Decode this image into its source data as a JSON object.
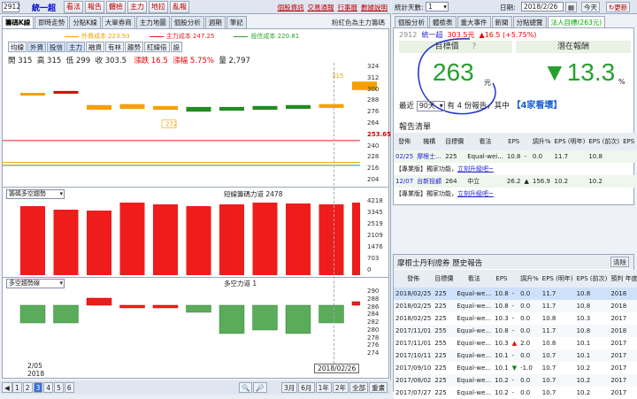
{
  "top_left": {
    "stock_code": "2912",
    "stock_name": "統一超",
    "buttons": [
      "看法",
      "報告",
      "體檢",
      "主力",
      "地拉",
      "亂報"
    ],
    "links": [
      "個股資訊",
      "交易通報",
      "行事曆",
      "數據說明"
    ]
  },
  "top_right": {
    "days_label": "統計天數:",
    "days_value": "1",
    "date_label": "日期:",
    "date_value": "2018/2/26",
    "today_btn": "今天",
    "refresh_btn": "更新"
  },
  "left_tabs": [
    "籌碼K線",
    "即時走勢",
    "分點K線",
    "大單券商",
    "主力地圖",
    "個股分析",
    "週期",
    "筆記"
  ],
  "chart_link": "粉紅色為主力籌碼",
  "legend": [
    {
      "label": "外資成本 223.93",
      "color": "#f5a000"
    },
    {
      "label": "主力成本 247.25",
      "color": "#e02020"
    },
    {
      "label": "投信成本 220.81",
      "color": "#2aa02a"
    }
  ],
  "toolbar": [
    "均線",
    "外資",
    "投信",
    "主力",
    "融資",
    "有林",
    "趨勢",
    "紅線倍",
    "設"
  ],
  "ohlc": {
    "open": "開 315",
    "high": "高 315",
    "low": "低 299",
    "close": "收 303.5",
    "change": "漲跌 16.5",
    "pct": "漲幅 5.75%",
    "volume": "量 2,797"
  },
  "price_ticks": [
    "324",
    "312",
    "300",
    "288",
    "276",
    "264",
    "253.65",
    "240",
    "228",
    "216",
    "204"
  ],
  "annotations": {
    "high_label": "315",
    "low_label": "272"
  },
  "chips_panel": {
    "select": "籌碼多空趨勢",
    "legend": "短線籌碼力道 2478",
    "ticks": [
      "4218",
      "3345",
      "2519",
      "2109",
      "1476",
      "703",
      "0"
    ]
  },
  "bullbear_panel": {
    "select": "多空趨勢線",
    "legend": "多空力道 1",
    "ticks": [
      "290",
      "288",
      "286",
      "284",
      "282",
      "280",
      "278",
      "276",
      "274"
    ]
  },
  "x_labels": {
    "left_date": "2/05",
    "left_year": "2018",
    "right_date": "2018/02/26"
  },
  "pager": [
    "1",
    "2",
    "3",
    "4",
    "5",
    "6"
  ],
  "range_btns": [
    "3月",
    "6月",
    "1年",
    "2年",
    "全部",
    "重畫"
  ],
  "chart_data": [
    {
      "type": "candlestick",
      "title": "",
      "candles": [
        {
          "o": 298,
          "c": 296,
          "color": "#f5a000"
        },
        {
          "o": 300,
          "c": 298,
          "color": "#e00000"
        },
        {
          "o": 285,
          "c": 280,
          "color": "#f5a000"
        },
        {
          "o": 286,
          "c": 281,
          "color": "#f5a000"
        },
        {
          "o": 284,
          "c": 280,
          "color": "#f5a000"
        },
        {
          "o": 283,
          "c": 278,
          "color": "#228b22"
        },
        {
          "o": 283,
          "c": 279,
          "color": "#228b22"
        },
        {
          "o": 284,
          "c": 280,
          "color": "#228b22"
        },
        {
          "o": 285,
          "c": 281,
          "color": "#228b22"
        },
        {
          "o": 286,
          "c": 282,
          "color": "#f5a000"
        },
        {
          "o": 310,
          "c": 301,
          "color": "#f5a000"
        }
      ],
      "ylim": [
        200,
        330
      ]
    },
    {
      "type": "bar",
      "title": "短線籌碼力道 2478",
      "values": [
        3900,
        3700,
        3650,
        4100,
        4000,
        3900,
        4000,
        4100,
        4050,
        4000,
        4100
      ],
      "ylim": [
        0,
        4400
      ]
    },
    {
      "type": "bar",
      "title": "多空力道 1",
      "values": [
        -5,
        -5,
        2,
        0,
        0,
        -2,
        -8,
        -7,
        -8,
        -5,
        1
      ],
      "ylim": [
        -15,
        5
      ]
    }
  ],
  "right_tabs": [
    "個股分析",
    "體檢表",
    "重大事件",
    "新聞",
    "分點總覽",
    "法人目標(263元)"
  ],
  "stock_header": {
    "code": "2912",
    "name": "統一超",
    "price": "303.5元",
    "change": "▲16.5 (+5.75%)"
  },
  "target": {
    "label": "目標價",
    "help": "?",
    "value": "263",
    "unit": "元",
    "upside_label": "潛在報酬",
    "upside_value": "▼13.3",
    "upside_unit": "%"
  },
  "recent": {
    "prefix": "最近",
    "select": "90天",
    "middle": "有 4 份報告，其中",
    "highlight": "【4家看壞】"
  },
  "report_table": {
    "title": "報告清單",
    "headers": [
      "發佈",
      "機構",
      "目標價",
      "看法",
      "EPS",
      "",
      "調升%",
      "EPS (明年)",
      "EPS (前次)",
      "EPS (前次)"
    ],
    "rows": [
      {
        "date": "02/25",
        "inst": "摩根士...",
        "target": "225",
        "view": "Equal-wei...",
        "eps": "10.8",
        "arrow": "-",
        "pct": "0.0",
        "eps1": "11.7",
        "eps2": "10.8"
      },
      {
        "promo": "【專業版】獨家功能，",
        "link": "立刻升級吧~"
      },
      {
        "date": "12/07",
        "inst": "台新投顧",
        "target": "264",
        "view": "中立",
        "eps": "26.2",
        "arrow": "▲",
        "pct": "156.9",
        "eps1": "10.2",
        "eps2": "10.2"
      },
      {
        "promo": "【專業版】獨家功能，",
        "link": "立刻升級吧~"
      }
    ]
  },
  "history": {
    "title": "摩根士丹利證券 歷史報告",
    "clear_btn": "清除",
    "headers": [
      "發佈",
      "目標價",
      "看法",
      "EPS",
      "",
      "調升%",
      "EPS (明年)",
      "EPS (前次)",
      "預判 年度"
    ],
    "rows": [
      {
        "date": "2018/02/25",
        "target": "225",
        "view": "Equal-we...",
        "eps": "10.8",
        "arrow": "-",
        "pct": "0.0",
        "e1": "11.7",
        "e2": "10.8",
        "year": "2018"
      },
      {
        "date": "2018/02/25",
        "target": "225",
        "view": "Equal-we...",
        "eps": "10.8",
        "arrow": "-",
        "pct": "0.0",
        "e1": "11.7",
        "e2": "10.8",
        "year": "2018"
      },
      {
        "date": "2018/02/25",
        "target": "225",
        "view": "Equal-we...",
        "eps": "10.3",
        "arrow": "-",
        "pct": "0.0",
        "e1": "10.8",
        "e2": "10.3",
        "year": "2017"
      },
      {
        "date": "2017/11/01",
        "target": "255",
        "view": "Equal-we...",
        "eps": "10.8",
        "arrow": "-",
        "pct": "0.0",
        "e1": "11.7",
        "e2": "10.8",
        "year": "2018"
      },
      {
        "date": "2017/11/01",
        "target": "255",
        "view": "Equal-we...",
        "eps": "10.3",
        "arrow": "▲",
        "pct": "2.0",
        "e1": "10.8",
        "e2": "10.1",
        "year": "2017"
      },
      {
        "date": "2017/10/11",
        "target": "225",
        "view": "Equal-we...",
        "eps": "10.1",
        "arrow": "-",
        "pct": "0.0",
        "e1": "10.7",
        "e2": "10.1",
        "year": "2017"
      },
      {
        "date": "2017/09/10",
        "target": "225",
        "view": "Equal-we...",
        "eps": "10.1",
        "arrow": "▼",
        "pct": "-1.0",
        "e1": "10.7",
        "e2": "10.2",
        "year": "2017"
      },
      {
        "date": "2017/08/02",
        "target": "225",
        "view": "Equal-we...",
        "eps": "10.2",
        "arrow": "-",
        "pct": "0.0",
        "e1": "10.7",
        "e2": "10.2",
        "year": "2017"
      },
      {
        "date": "2017/07/27",
        "target": "225",
        "view": "Equal-we...",
        "eps": "10.2",
        "arrow": "-",
        "pct": "0.0",
        "e1": "10.7",
        "e2": "10.2",
        "year": "2017"
      }
    ]
  }
}
